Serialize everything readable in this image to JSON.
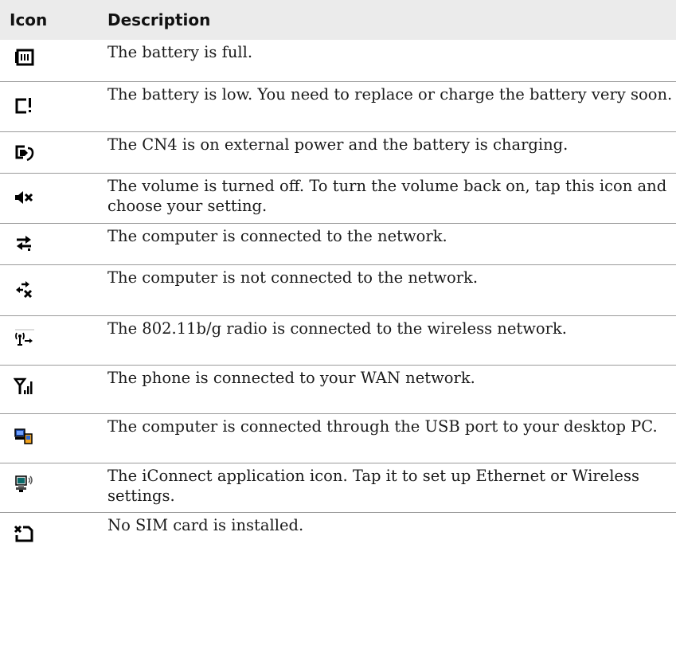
{
  "table": {
    "header": {
      "icon": "Icon",
      "description": "Description"
    },
    "rows": [
      {
        "icon": "battery-full-icon",
        "description": "The battery is full."
      },
      {
        "icon": "battery-low-icon",
        "description": "The battery is low. You need to replace or charge the battery very soon."
      },
      {
        "icon": "battery-charging-icon",
        "description": "The CN4 is on external power and the battery is charging."
      },
      {
        "icon": "volume-off-icon",
        "description": "The volume is turned off. To turn the volume back on, tap this icon and choose your setting."
      },
      {
        "icon": "network-connected-icon",
        "description": "The computer is connected to the network."
      },
      {
        "icon": "network-disconnected-icon",
        "description": "The computer is not connected to the network."
      },
      {
        "icon": "wireless-radio-icon",
        "description": "The 802.11b/g radio is connected to the wireless network."
      },
      {
        "icon": "wan-signal-icon",
        "description": "The phone is connected to your WAN network."
      },
      {
        "icon": "usb-connection-icon",
        "description": "The computer is connected through the USB port to your desktop PC."
      },
      {
        "icon": "iconnect-icon",
        "description": "The iConnect application icon. Tap it to set up Ethernet or Wireless settings."
      },
      {
        "icon": "no-sim-icon",
        "description": "No SIM card is installed."
      }
    ]
  }
}
